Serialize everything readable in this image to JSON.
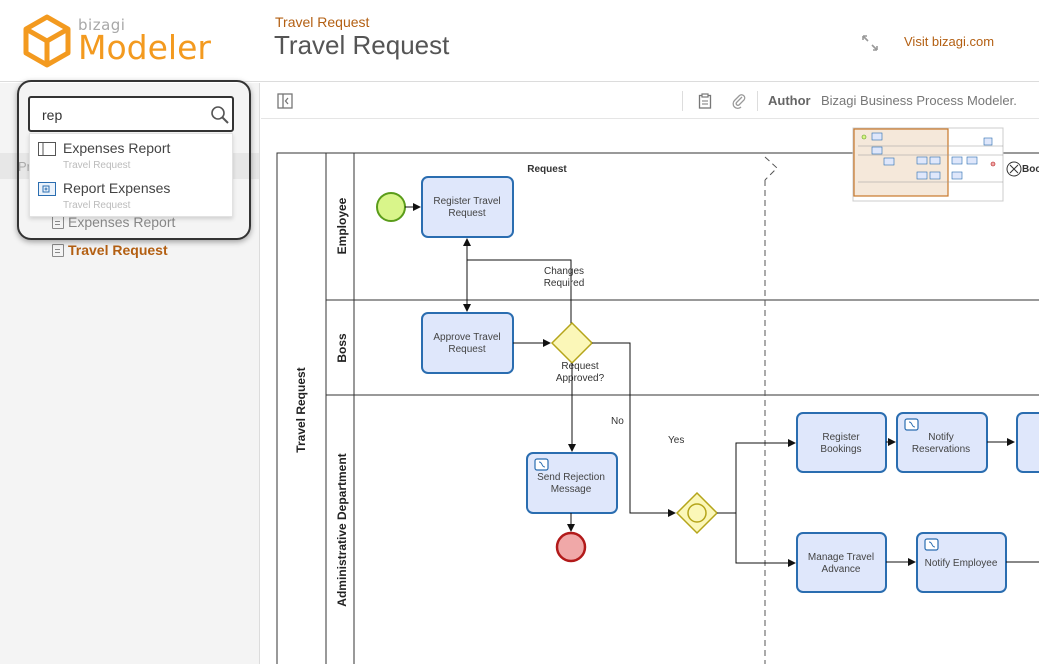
{
  "header": {
    "logo_brand": "bizagi",
    "logo_product": "Modeler",
    "breadcrumb": "Travel Request",
    "title": "Travel Request",
    "visit_link": "Visit bizagi.com",
    "brand_color": "#f39a1f",
    "accent_color": "#b35f12"
  },
  "search": {
    "value": "rep",
    "results": [
      {
        "label": "Expenses Report",
        "sub": "Travel Request",
        "icon": "process-icon"
      },
      {
        "label": "Report Expenses",
        "sub": "Travel Request",
        "icon": "subprocess-icon"
      }
    ]
  },
  "sidebar": {
    "bg_snippet": "Pr",
    "items": [
      {
        "label": "Expenses Report"
      },
      {
        "label": "Travel Request"
      }
    ]
  },
  "toolbar": {
    "author_label": "Author",
    "author_value": "Bizagi Business Process Modeler."
  },
  "diagram": {
    "pool": "Travel Request",
    "phase": "Request",
    "lanes": [
      "Employee",
      "Boss",
      "Administrative Department"
    ],
    "tasks": {
      "register_travel": [
        "Register Travel",
        "Request"
      ],
      "approve_travel": [
        "Approve Travel",
        "Request"
      ],
      "send_rejection": [
        "Send Rejection",
        "Message"
      ],
      "register_bookings": [
        "Register",
        "Bookings"
      ],
      "notify_reservations": [
        "Notify",
        "Reservations"
      ],
      "manage_advance": [
        "Manage Travel",
        "Advance"
      ],
      "notify_employee": [
        "Notify Employee"
      ]
    },
    "gateway_label": [
      "Request",
      "Approved?"
    ],
    "flow_changes": [
      "Changes",
      "Required"
    ],
    "flow_no": "No",
    "flow_yes": "Yes",
    "edge_text": "Boo"
  }
}
